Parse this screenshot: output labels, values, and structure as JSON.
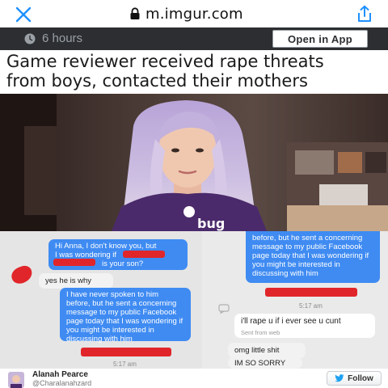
{
  "browser": {
    "url": "m.imgur.com",
    "close_icon": "close-icon",
    "lock_icon": "lock-icon",
    "share_icon": "share-icon",
    "accent": "#1e90ff"
  },
  "post": {
    "time": "6 hours",
    "open_in_app": "Open in App",
    "headline_line1": "Game reviewer received rape threats",
    "headline_line2": "from boys, contacted their mothers"
  },
  "photo": {
    "shirt_text": "bug"
  },
  "chat": {
    "left": [
      {
        "type": "out",
        "line1": "Hi Anna, I don't know you, but",
        "line2": "I was wondering if",
        "line3": "is your son?"
      },
      {
        "type": "in",
        "text": "yes he is why"
      },
      {
        "type": "out",
        "text": "I have never spoken to him before, but he sent a concerning message to my public Facebook page today that I was wondering if you might be interested in discussing with him"
      },
      {
        "type": "timestamp",
        "text": "5:17 am"
      }
    ],
    "right": [
      {
        "type": "out",
        "text": "before, but he sent a concerning message to my public Facebook page today that I was wondering if you might be interested in discussing with him"
      },
      {
        "type": "timestamp",
        "text": "5:17 am"
      },
      {
        "type": "in",
        "text": "i'll rape u if i ever see u cunt",
        "sub": "Sent from web"
      },
      {
        "type": "in",
        "text": "omg little shit"
      },
      {
        "type": "in",
        "text": "IM SO SORRY"
      }
    ]
  },
  "footer": {
    "author_name": "Alanah Pearce",
    "author_handle": "@Charalanahzard",
    "follow_label": "Follow"
  },
  "colors": {
    "bubble_blue": "#3f8bf2",
    "redaction": "#e0262a",
    "post_bar": "#2c2e31"
  }
}
